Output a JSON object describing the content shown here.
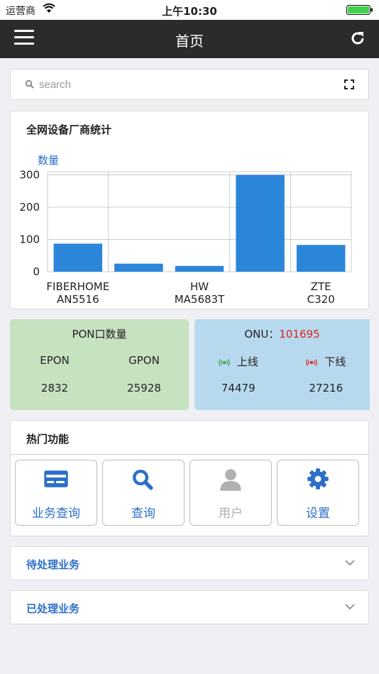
{
  "status_bar": {
    "carrier": "运营商",
    "time": "上午10:30"
  },
  "nav": {
    "title": "首页"
  },
  "search": {
    "placeholder": "search"
  },
  "chart_card": {
    "title": "全网设备厂商统计"
  },
  "chart_data": {
    "type": "bar",
    "ylabel": "数量",
    "categories": [
      "FIBERHOME AN5516",
      "",
      "HW MA5683T",
      "ZTE C320",
      ""
    ],
    "category_labels": [
      {
        "line1": "FIBERHOME",
        "line2": "AN5516"
      },
      {
        "line1": "HW",
        "line2": "MA5683T"
      },
      {
        "line1": "ZTE",
        "line2": "C320"
      }
    ],
    "values": [
      87,
      25,
      18,
      300,
      83
    ],
    "yticks": [
      "300",
      "200",
      "100",
      "0"
    ],
    "ylim": [
      0,
      310
    ],
    "grid": true,
    "bar_color": "#2b86d9"
  },
  "pon": {
    "title": "PON口数量",
    "epon_label": "EPON",
    "gpon_label": "GPON",
    "epon_value": "2832",
    "gpon_value": "25928"
  },
  "onu": {
    "title_prefix": "ONU：",
    "total": "101695",
    "online_label": "上线",
    "offline_label": "下线",
    "online_value": "74479",
    "offline_value": "27216"
  },
  "hot": {
    "title": "热门功能",
    "items": [
      {
        "label": "业务查询",
        "icon": "card-icon"
      },
      {
        "label": "查询",
        "icon": "search-icon"
      },
      {
        "label": "用户",
        "icon": "user-icon"
      },
      {
        "label": "设置",
        "icon": "gear-icon"
      }
    ]
  },
  "pending": {
    "title": "待处理业务"
  },
  "processed": {
    "title": "已处理业务"
  },
  "colors": {
    "accent": "#2c6fc9",
    "nav_bg": "#2b2b2b",
    "pon_bg": "#c6e2c1",
    "onu_bg": "#b7d9ee",
    "alert": "#e02020",
    "online": "#3aa14a",
    "battery": "#3fd14a"
  }
}
